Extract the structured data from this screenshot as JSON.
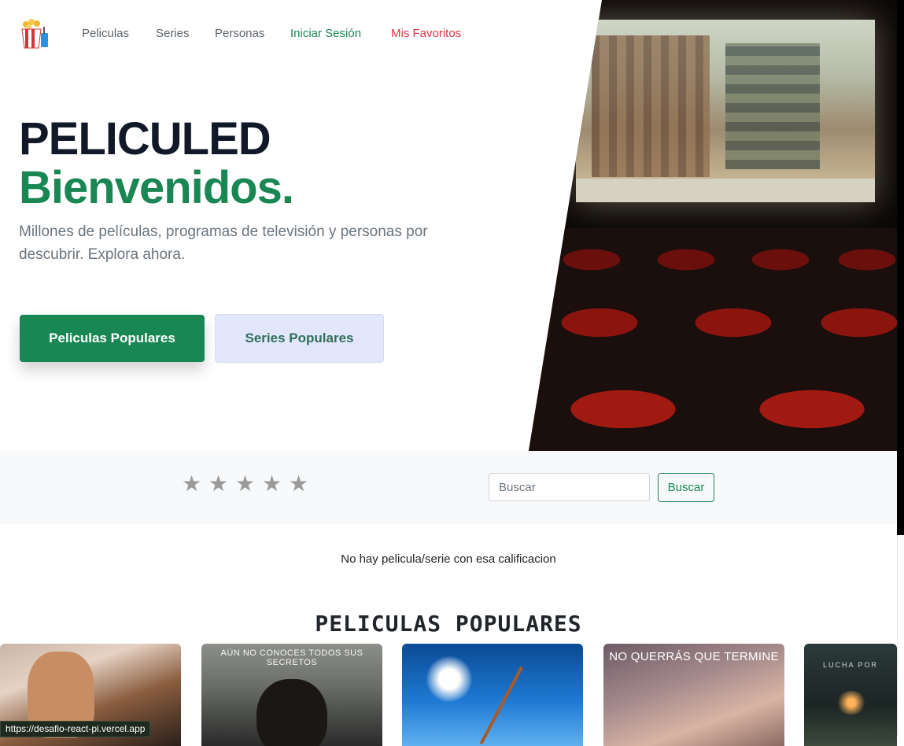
{
  "nav": {
    "logo_icon": "popcorn-icon",
    "links": [
      "Peliculas",
      "Series",
      "Personas"
    ],
    "login": "Iniciar Sesión",
    "favorites": "Mis Favoritos",
    "login_color": "#198754",
    "favorites_color": "#dc3545"
  },
  "hero": {
    "title": "PELICULED",
    "subtitle_title": "Bienvenidos.",
    "description": "Millones de películas, programas de televisión y personas por descubrir. Explora ahora.",
    "primary_button": "Peliculas Populares",
    "secondary_button": "Series Populares",
    "accent_color": "#198754",
    "image": "cinema-audience-image"
  },
  "filter": {
    "rating_stars": 5,
    "star_glyph": "★",
    "rating_selected": 0,
    "search_placeholder": "Buscar",
    "search_button": "Buscar"
  },
  "empty_message": "No hay pelicula/serie con esa calificacion",
  "section": {
    "title": "PELICULAS POPULARES",
    "posters": [
      {
        "caption": ""
      },
      {
        "caption": "AÚN NO CONOCES TODOS SUS SECRETOS"
      },
      {
        "caption": ""
      },
      {
        "caption": "NO QUERRÁS QUE TERMINE"
      },
      {
        "caption": "LUCHA POR"
      }
    ]
  },
  "status_bar": {
    "url": "https://desafio-react-pi.vercel.app"
  }
}
